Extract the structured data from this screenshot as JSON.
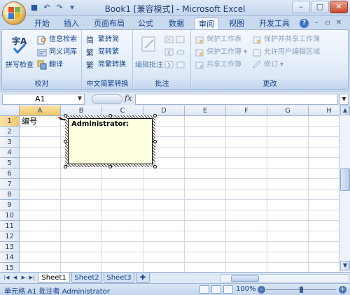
{
  "title": "Book1 [兼容模式] - Microsoft Excel",
  "tabs": [
    "开始",
    "插入",
    "页面布局",
    "公式",
    "数据",
    "审阅",
    "视图",
    "开发工具"
  ],
  "active_tab": "审阅",
  "groups": {
    "proofing": {
      "label": "校对",
      "big_button": "拼写检查",
      "items": [
        "信息检索",
        "同义词库",
        "翻译"
      ]
    },
    "chinese": {
      "label": "中文简繁转换",
      "items": [
        "繁转简",
        "简转繁",
        "简繁转换"
      ]
    },
    "comments": {
      "label": "批注",
      "big_button": "编辑批注"
    },
    "changes": {
      "label": "更改",
      "items": [
        "保护工作表",
        "保护工作簿",
        "共享工作簿",
        "保护并共享工作簿",
        "允许用户编辑区域",
        "修订"
      ]
    }
  },
  "formula_bar": {
    "name_box": "A1",
    "fx_label": "fx",
    "content": ""
  },
  "columns": [
    "A",
    "B",
    "C",
    "D",
    "E",
    "F",
    "G",
    "H"
  ],
  "rows": [
    "1",
    "2",
    "3",
    "4",
    "5",
    "6",
    "7",
    "8",
    "9",
    "10",
    "11",
    "12",
    "13",
    "14",
    "15"
  ],
  "cells": {
    "A1": "编号"
  },
  "comment": {
    "author": "Administrator:",
    "text": ""
  },
  "sheets": [
    "Sheet1",
    "Sheet2",
    "Sheet3"
  ],
  "active_sheet": "Sheet1",
  "status": {
    "text": "单元格 A1 批注者 Administrator",
    "zoom": "100%"
  },
  "colors": {
    "accent": "#15428b",
    "ribbon": "#dfe9f7",
    "comment_bg": "#ffffe1"
  }
}
